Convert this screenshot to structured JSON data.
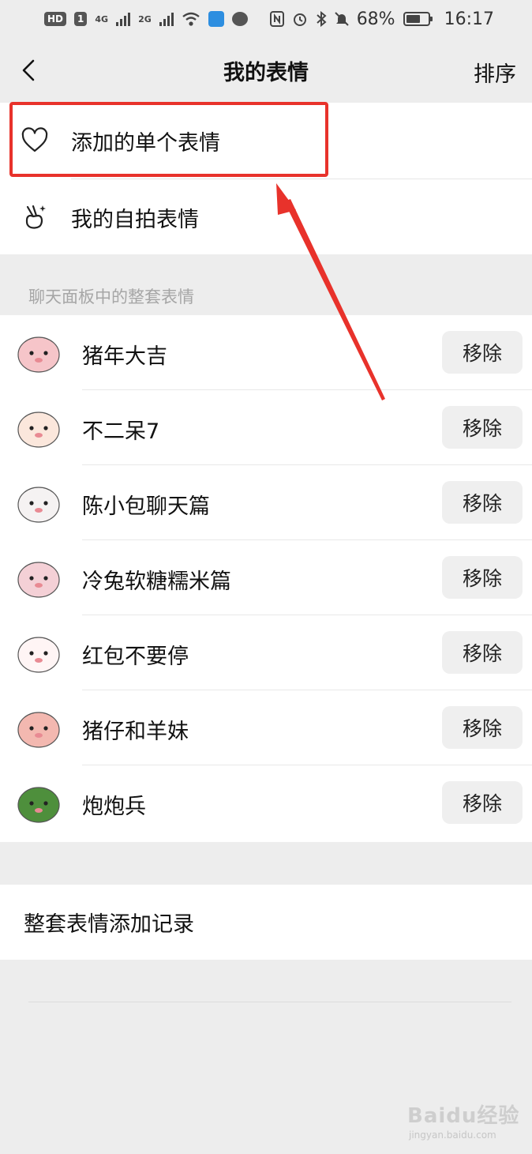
{
  "status_bar": {
    "hd_label": "HD",
    "sim_label": "1",
    "network_1": "4G",
    "network_2": "2G",
    "battery_text": "68%",
    "battery_level": 0.68,
    "time": "16:17"
  },
  "nav": {
    "title": "我的表情",
    "sort_label": "排序"
  },
  "top_menu": {
    "items": [
      {
        "label": "添加的单个表情",
        "icon": "heart-icon"
      },
      {
        "label": "我的自拍表情",
        "icon": "victory-hand-icon"
      }
    ]
  },
  "sticker_sets": {
    "section_label": "聊天面板中的整套表情",
    "remove_label": "移除",
    "items": [
      {
        "name": "猪年大吉",
        "icon": "pig-sticker-icon"
      },
      {
        "name": "不二呆7",
        "icon": "bun-sticker-icon"
      },
      {
        "name": "陈小包聊天篇",
        "icon": "dumpling-sticker-icon"
      },
      {
        "name": "冷兔软糖糯米篇",
        "icon": "rabbit-sticker-icon"
      },
      {
        "name": "红包不要停",
        "icon": "bunny-bow-sticker-icon"
      },
      {
        "name": "猪仔和羊妹",
        "icon": "piglet-sticker-icon"
      },
      {
        "name": "炮炮兵",
        "icon": "soldier-sticker-icon"
      }
    ]
  },
  "history": {
    "label": "整套表情添加记录"
  },
  "annotation": {
    "color": "#e8322b"
  },
  "watermark": {
    "brand": "Baidu经验",
    "url": "jingyan.baidu.com"
  }
}
